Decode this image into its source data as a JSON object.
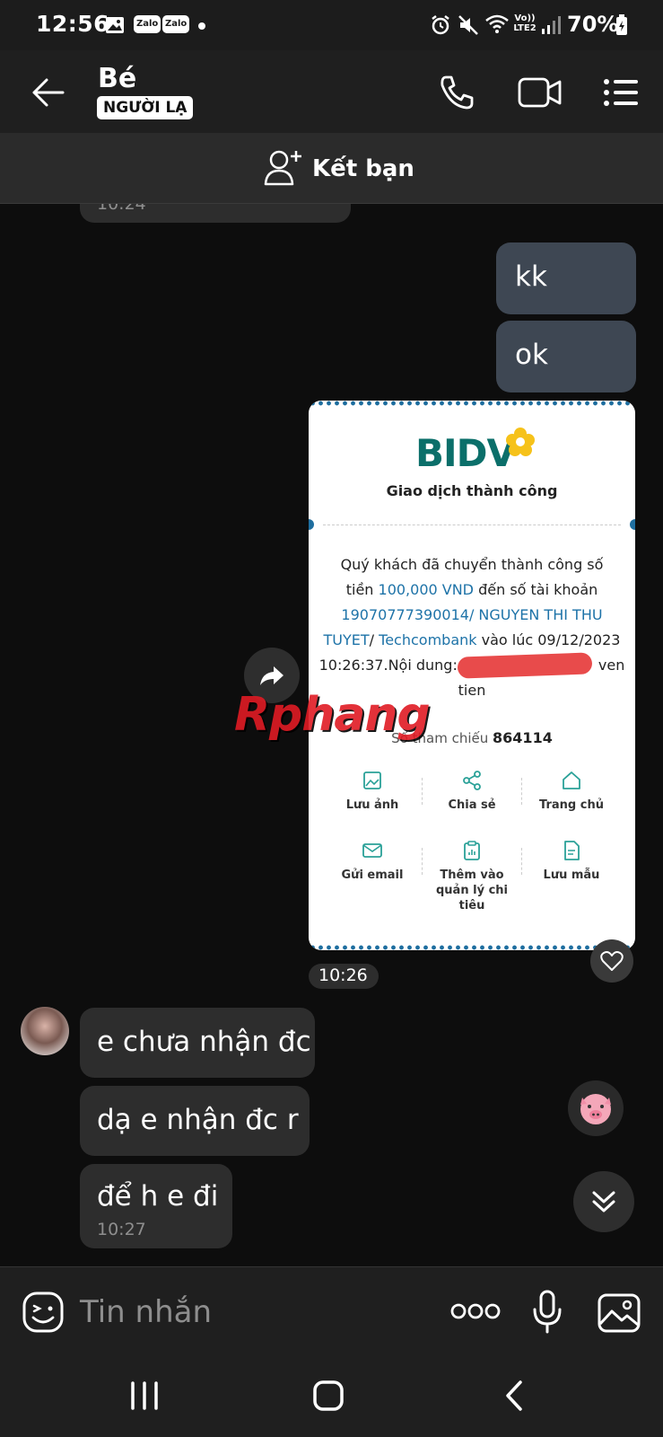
{
  "status_bar": {
    "time": "12:56",
    "app_badges": [
      "Zalo",
      "Zalo"
    ],
    "network": "Vo)) LTE2",
    "battery": "70%"
  },
  "header": {
    "contact_name": "Bé",
    "stranger_tag": "NGƯỜI LẠ",
    "icons": [
      "back-arrow-icon",
      "phone-icon",
      "video-call-icon",
      "menu-icon"
    ]
  },
  "friend_bar": {
    "label": "Kết bạn"
  },
  "messages": {
    "prev_time": "10:24",
    "out_1": "kk",
    "out_2": "ok",
    "image_time": "10:26",
    "in_1": "e chưa nhận đc",
    "in_2": "dạ e nhận đc r",
    "in_3": "để h e đi",
    "in_3_time": "10:27"
  },
  "receipt": {
    "bank": "BIDV",
    "status": "Giao dịch thành công",
    "line1": "Quý khách đã chuyển thành công số",
    "line2_pre": "tiền ",
    "amount": "100,000 VND",
    "line2_post": " đến số tài khoản",
    "account": "19070777390014",
    "name_part1": "/ NGUYEN THI THU",
    "name_part2": "TUYET",
    "bank_to": "Techcombank",
    "line4_post": " vào lúc 09/12/2023",
    "line5_pre": "10:26:37.Nội dung: N",
    "line5_post": "ven",
    "line6": "tien",
    "ref_label": "Số tham chiếu ",
    "ref_value": "864114",
    "actions": [
      "Lưu ảnh",
      "Chia sẻ",
      "Trang chủ",
      "Gửi email",
      "Thêm vào quản lý chi tiêu",
      "Lưu mẫu"
    ]
  },
  "watermark": "Rphang",
  "input": {
    "placeholder": "Tin nhắn"
  },
  "colors": {
    "accent_blue": "#1e73a8",
    "bidv_teal": "#0b6f6a",
    "outgoing_bubble": "#3e4753",
    "incoming_bubble": "#2d2d2d"
  }
}
